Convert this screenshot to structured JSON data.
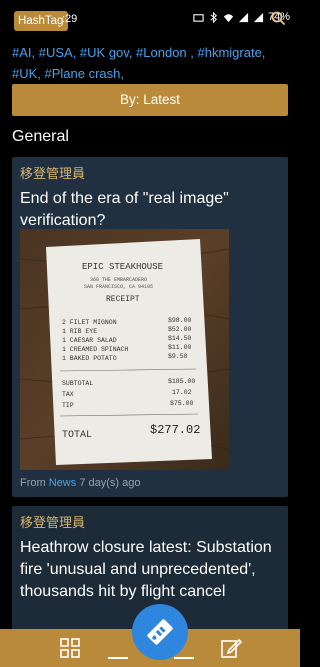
{
  "status_bar": {
    "app_label": "HashTag",
    "time": ":29",
    "battery": "74%"
  },
  "hashtags": {
    "text": "#AI, #USA, #UK gov, #London , #hkmigrate, #UK, #Plane crash,"
  },
  "sort_button": {
    "label": "By: Latest"
  },
  "section": {
    "title": "General"
  },
  "cards": [
    {
      "author": "移登管理員",
      "title": "End of the era of \"real image\" verification?",
      "meta_from": "From",
      "meta_source": "News",
      "meta_age": "7 day(s) ago"
    },
    {
      "author": "移登管理員",
      "title": "Heathrow closure latest: Substation fire 'unusual and unprecedented', thousands hit by flight cancel"
    }
  ],
  "receipt": {
    "header": "EPIC STEAKHOUSE",
    "address1": "360 THE EMBARCADERO",
    "address2": "SAN FRANCISCO, CA 94105",
    "label": "RECEIPT",
    "items": [
      {
        "name": "2 FILET MIGNON",
        "price": "$98.00"
      },
      {
        "name": "1 RIB EYE",
        "price": "$52.00"
      },
      {
        "name": "1 CAESAR SALAD",
        "price": "$14.50"
      },
      {
        "name": "1 CREAMED SPINACH",
        "price": "$11.00"
      },
      {
        "name": "1 BAKED POTATO",
        "price": "$9.50"
      }
    ],
    "subtotal_label": "SUBTOTAL",
    "subtotal": "$185.00",
    "tax_label": "TAX",
    "tax": "17.02",
    "tip_label": "TIP",
    "tip": "$75.00",
    "total_label": "TOTAL",
    "total": "$277.02"
  },
  "colors": {
    "accent": "#b98a3a",
    "link": "#4aa0e8",
    "card_bg": "#203040",
    "author": "#d7b46e",
    "fab": "#2e86df"
  },
  "icons": [
    "search-icon",
    "grid-icon",
    "edit-icon",
    "tag-icon",
    "wifi-icon",
    "signal-icon",
    "battery-icon"
  ]
}
